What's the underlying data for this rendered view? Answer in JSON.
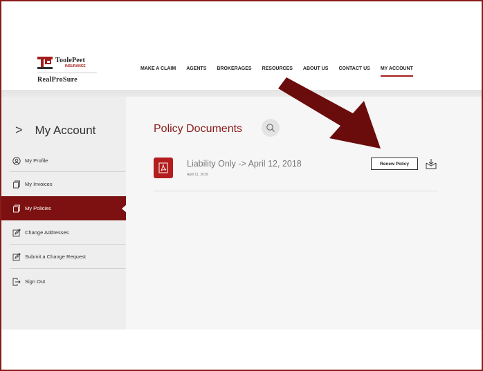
{
  "logo": {
    "brand": "ToolePeet",
    "sub": "INSURANCE",
    "product": "RealProSure"
  },
  "nav": {
    "items": [
      "MAKE A CLAIM",
      "AGENTS",
      "BROKERAGES",
      "RESOURCES",
      "ABOUT US",
      "CONTACT US",
      "MY ACCOUNT"
    ],
    "active": "MY ACCOUNT"
  },
  "sidebar": {
    "title": "My Account",
    "items": [
      {
        "label": "My Profile",
        "icon": "profile-icon"
      },
      {
        "label": "My Invoices",
        "icon": "copy-icon"
      },
      {
        "label": "My Policies",
        "icon": "copy-icon",
        "active": true
      },
      {
        "label": "Change Addresses",
        "icon": "edit-icon"
      },
      {
        "label": "Submit a Change Request",
        "icon": "edit-icon"
      },
      {
        "label": "Sign Out",
        "icon": "sign-out-icon"
      }
    ]
  },
  "main": {
    "title": "Policy Documents",
    "document": {
      "title": "Liability Only -> April 12, 2018",
      "date": "April 11, 2019",
      "renew_label": "Renew Policy"
    }
  },
  "colors": {
    "brand": "#8b1a1a",
    "active_bg": "#7d1111",
    "pdf_red": "#b31d1d",
    "arrow": "#6b0c0c"
  }
}
